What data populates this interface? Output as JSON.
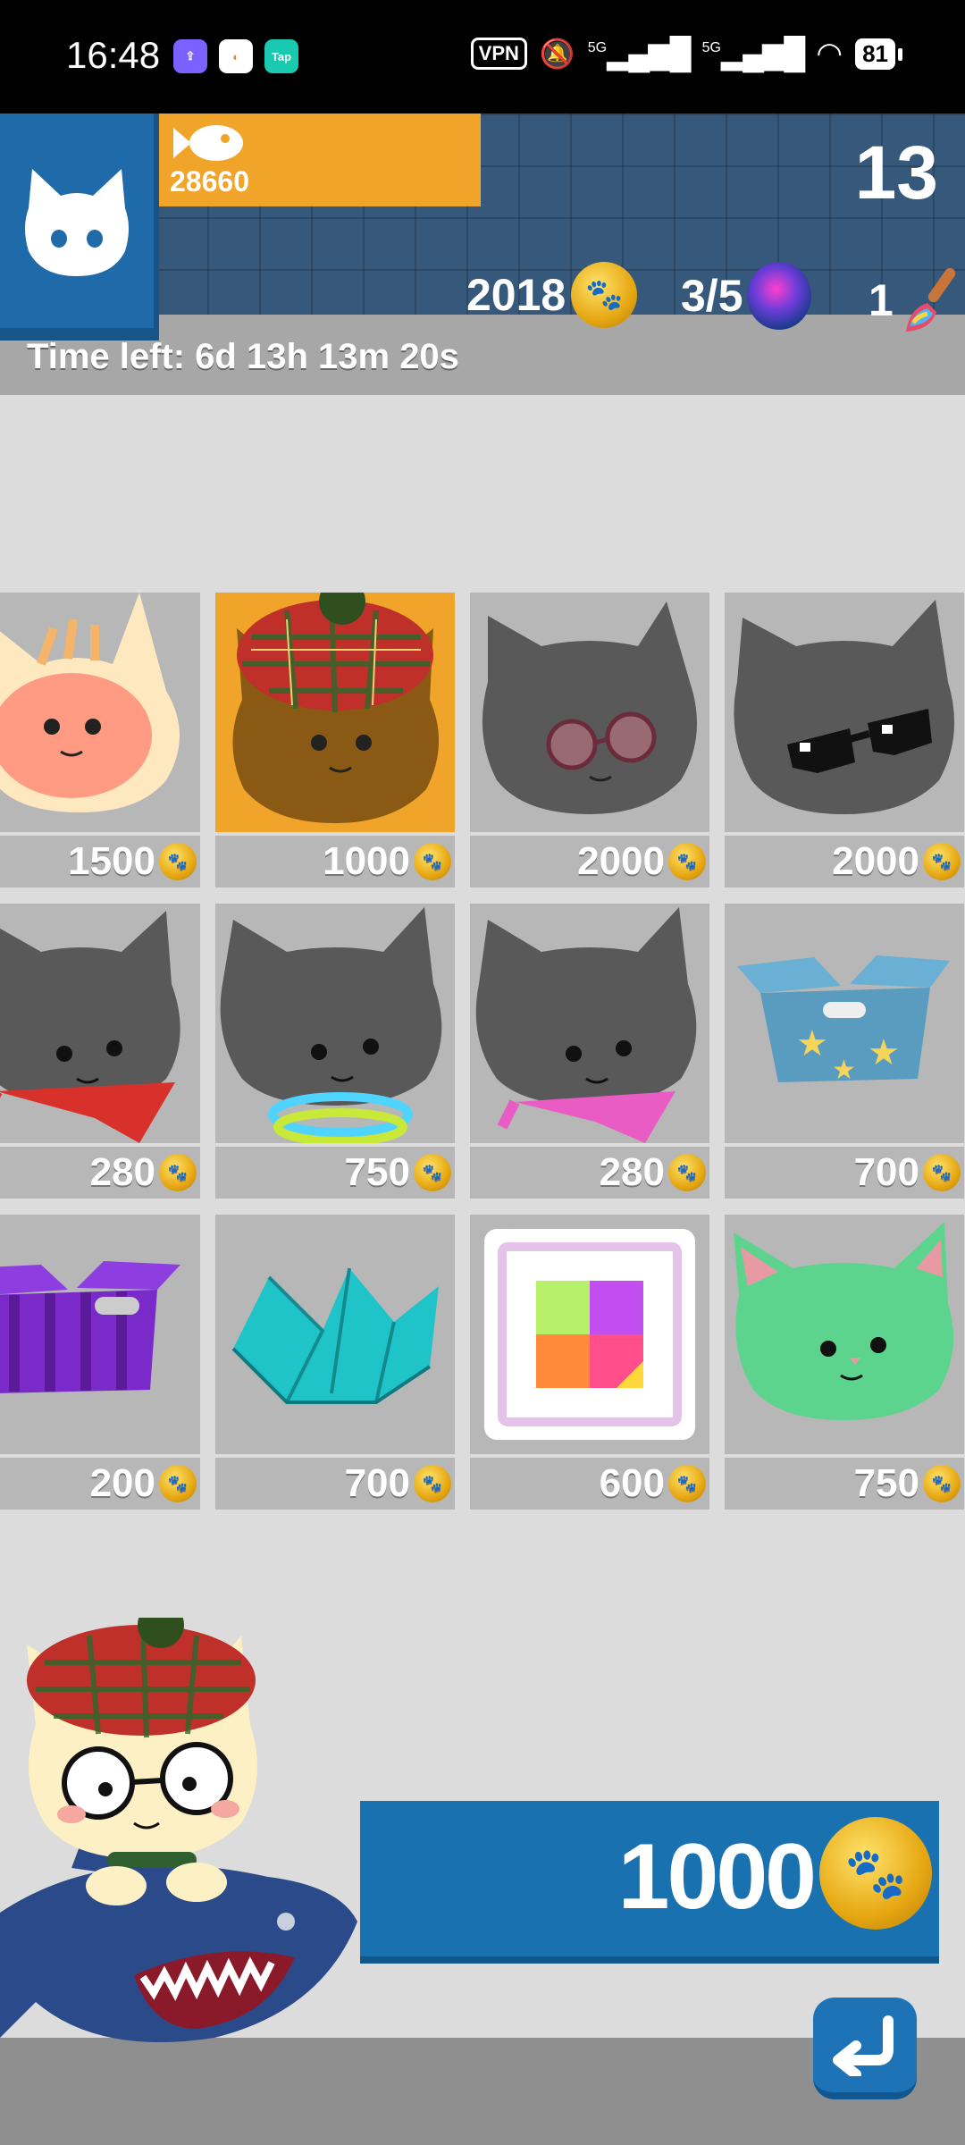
{
  "status_bar": {
    "time": "16:48",
    "vpn": "VPN",
    "signal1": "5G",
    "signal2": "5G",
    "battery": "81"
  },
  "header": {
    "fish_count": "28660",
    "level": "13",
    "coins": "2018",
    "gems": "3/5",
    "brushes": "1",
    "time_left": "Time left: 6d 13h 13m 20s"
  },
  "shop_items": [
    {
      "name": "cream-cat",
      "price": "1500"
    },
    {
      "name": "tartan-beret",
      "price": "1000"
    },
    {
      "name": "round-glasses",
      "price": "2000"
    },
    {
      "name": "pixel-sunglasses",
      "price": "2000"
    },
    {
      "name": "red-bandana",
      "price": "280"
    },
    {
      "name": "glow-collar",
      "price": "750"
    },
    {
      "name": "pink-bandana",
      "price": "280"
    },
    {
      "name": "star-box",
      "price": "700"
    },
    {
      "name": "purple-box",
      "price": "200"
    },
    {
      "name": "origami-bed",
      "price": "700"
    },
    {
      "name": "color-frame",
      "price": "600"
    },
    {
      "name": "green-cat",
      "price": "750"
    }
  ],
  "buy_button": {
    "price": "1000"
  },
  "colors": {
    "accent": "#f0a52a",
    "primary": "#1971b0",
    "header": "#36587a"
  }
}
